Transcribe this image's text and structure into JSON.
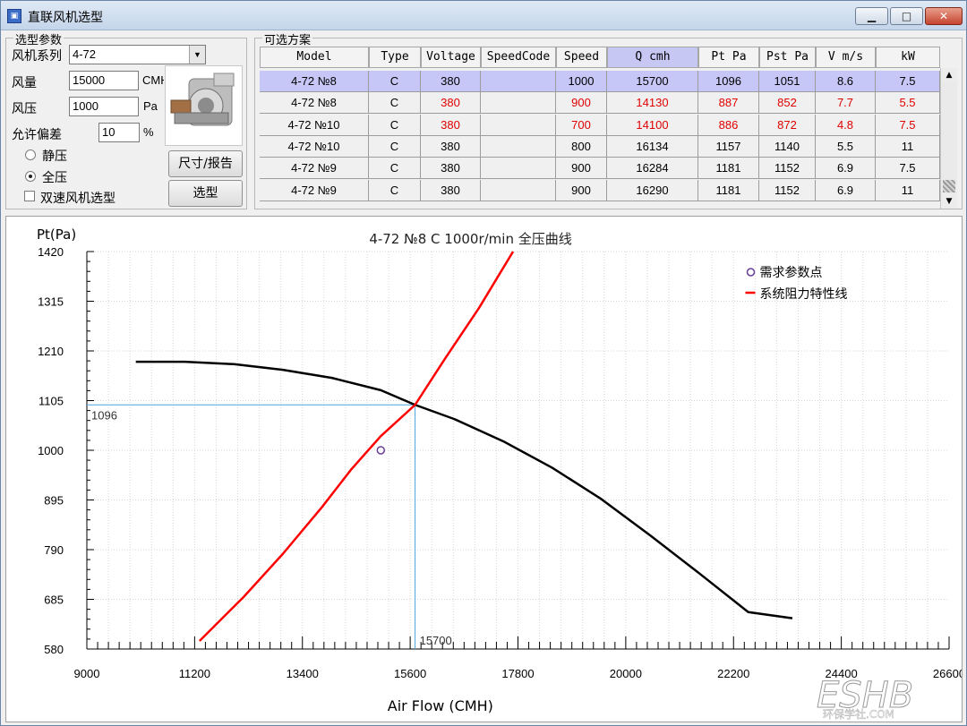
{
  "window": {
    "title": "直联风机选型",
    "icon": "app-window-icon"
  },
  "params": {
    "group_title": "选型参数",
    "series_label": "风机系列",
    "series_value": "4-72",
    "flow_label": "风量",
    "flow_value": "15000",
    "flow_unit": "CMH",
    "pressure_label": "风压",
    "pressure_value": "1000",
    "pressure_unit": "Pa",
    "tolerance_label": "允许偏差",
    "tolerance_value": "10",
    "tolerance_unit": "%",
    "radio_static": "静压",
    "radio_total": "全压",
    "selected_pressure_mode": "全压",
    "dual_speed_label": "双速风机选型",
    "dual_speed_checked": false,
    "size_report_button": "尺寸/报告",
    "select_button": "选型"
  },
  "options": {
    "group_title": "可选方案",
    "columns": [
      "Model",
      "Type",
      "Voltage",
      "SpeedCode",
      "Speed",
      "Q cmh",
      "Pt Pa",
      "Pst Pa",
      "V m/s",
      "kW"
    ],
    "active_column": "Q cmh",
    "rows": [
      {
        "cells": [
          "4-72 №8",
          "C",
          "380",
          "",
          "1000",
          "15700",
          "1096",
          "1051",
          "8.6",
          "7.5"
        ],
        "selected": true,
        "highlight": false
      },
      {
        "cells": [
          "4-72 №8",
          "C",
          "380",
          "",
          "900",
          "14130",
          "887",
          "852",
          "7.7",
          "5.5"
        ],
        "selected": false,
        "highlight": true
      },
      {
        "cells": [
          "4-72 №10",
          "C",
          "380",
          "",
          "700",
          "14100",
          "886",
          "872",
          "4.8",
          "7.5"
        ],
        "selected": false,
        "highlight": true
      },
      {
        "cells": [
          "4-72 №10",
          "C",
          "380",
          "",
          "800",
          "16134",
          "1157",
          "1140",
          "5.5",
          "11"
        ],
        "selected": false,
        "highlight": false
      },
      {
        "cells": [
          "4-72 №9",
          "C",
          "380",
          "",
          "900",
          "16284",
          "1181",
          "1152",
          "6.9",
          "7.5"
        ],
        "selected": false,
        "highlight": false
      },
      {
        "cells": [
          "4-72 №9",
          "C",
          "380",
          "",
          "900",
          "16290",
          "1181",
          "1152",
          "6.9",
          "11"
        ],
        "selected": false,
        "highlight": false
      }
    ],
    "highlight_color": "#e00000",
    "selection_color": "#c6c6f7"
  },
  "chart_data": {
    "type": "line",
    "title": "4-72 №8 C  1000r/min   全压曲线",
    "xlabel": "Air Flow  (CMH)",
    "ylabel": "Pt(Pa)",
    "xlim": [
      9000,
      26600
    ],
    "ylim": [
      580,
      1420
    ],
    "x_ticks": [
      9000,
      11200,
      13400,
      15600,
      17800,
      20000,
      22200,
      24400,
      26600
    ],
    "y_ticks": [
      580,
      685,
      790,
      895,
      1000,
      1105,
      1210,
      1315,
      1420
    ],
    "grid": true,
    "legend": {
      "placement": "top-right",
      "entries": [
        {
          "name": "需求参数点",
          "color": "#6a3d9a",
          "marker": "circle"
        },
        {
          "name": "系统阻力特性线",
          "color": "#ff0000",
          "marker": "line"
        }
      ]
    },
    "series": [
      {
        "name": "全压曲线",
        "color": "#000000",
        "x": [
          10000,
          11000,
          12000,
          13000,
          14000,
          15000,
          15700,
          16500,
          17500,
          18500,
          19500,
          20500,
          21500,
          22500,
          23400
        ],
        "y": [
          1187,
          1187,
          1182,
          1170,
          1153,
          1127,
          1096,
          1066,
          1019,
          963,
          897,
          820,
          740,
          658,
          645
        ]
      },
      {
        "name": "系统阻力特性线",
        "color": "#ff0000",
        "x": [
          11300,
          12200,
          13000,
          13800,
          14400,
          15000,
          15700,
          16300,
          17000,
          17700
        ],
        "y": [
          597,
          690,
          781,
          880,
          960,
          1030,
          1096,
          1192,
          1300,
          1420
        ]
      }
    ],
    "demand_point": {
      "x": 15000,
      "y": 1000
    },
    "operating_point": {
      "x": 15700,
      "y": 1096,
      "x_label": "15700",
      "y_label": "1096",
      "guide_color": "#4aa3df"
    }
  },
  "watermark": {
    "text": "ESHB",
    "subtext": "环保学社.COM"
  }
}
